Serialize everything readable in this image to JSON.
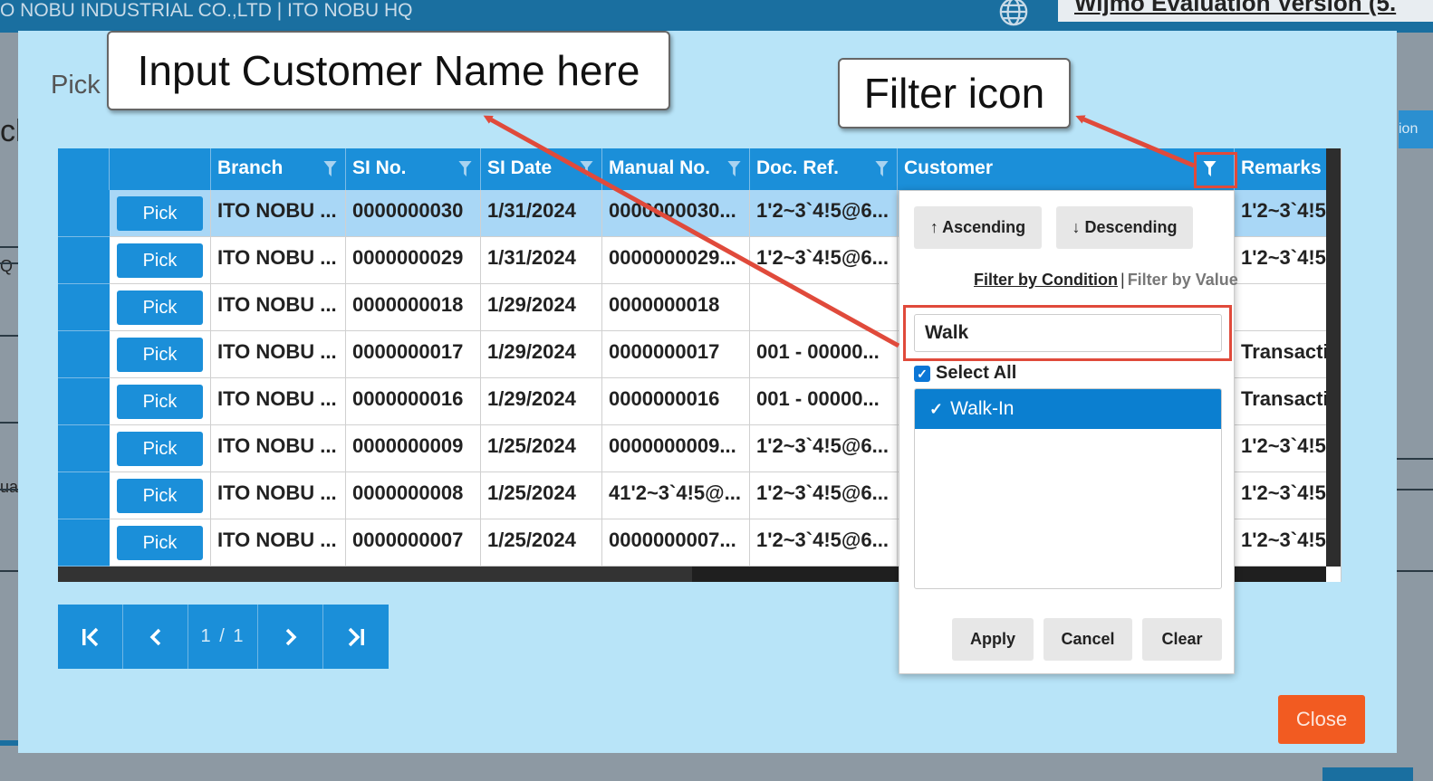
{
  "app": {
    "company": "O NOBU INDUSTRIAL CO.,LTD | ITO NOBU HQ",
    "evaluation_banner": "Wijmo Evaluation Version (5."
  },
  "background": {
    "pk": "ck",
    "q": "Q",
    "ual": "ual",
    "right_btn": "ion"
  },
  "modal": {
    "title": "Pick S",
    "close_label": "Close"
  },
  "grid": {
    "columns": [
      "Branch",
      "SI No.",
      "SI Date",
      "Manual No.",
      "Doc. Ref.",
      "Customer",
      "Remarks"
    ],
    "pick_label": "Pick",
    "rows": [
      {
        "branch": "ITO NOBU ...",
        "si_no": "0000000030",
        "si_date": "1/31/2024",
        "manual_no": "0000000030...",
        "doc_ref": "1'2~3`4!5@6...",
        "customer": "",
        "remarks": "1'2~3`4!5"
      },
      {
        "branch": "ITO NOBU ...",
        "si_no": "0000000029",
        "si_date": "1/31/2024",
        "manual_no": "0000000029...",
        "doc_ref": "1'2~3`4!5@6...",
        "customer": "",
        "remarks": "1'2~3`4!5"
      },
      {
        "branch": "ITO NOBU ...",
        "si_no": "0000000018",
        "si_date": "1/29/2024",
        "manual_no": "0000000018",
        "doc_ref": "",
        "customer": "",
        "remarks": ""
      },
      {
        "branch": "ITO NOBU ...",
        "si_no": "0000000017",
        "si_date": "1/29/2024",
        "manual_no": "0000000017",
        "doc_ref": "001 - 00000...",
        "customer": "",
        "remarks": "Transacti"
      },
      {
        "branch": "ITO NOBU ...",
        "si_no": "0000000016",
        "si_date": "1/29/2024",
        "manual_no": "0000000016",
        "doc_ref": "001 - 00000...",
        "customer": "",
        "remarks": "Transacti"
      },
      {
        "branch": "ITO NOBU ...",
        "si_no": "0000000009",
        "si_date": "1/25/2024",
        "manual_no": "0000000009...",
        "doc_ref": "1'2~3`4!5@6...",
        "customer": "",
        "remarks": "1'2~3`4!5"
      },
      {
        "branch": "ITO NOBU ...",
        "si_no": "0000000008",
        "si_date": "1/25/2024",
        "manual_no": "41'2~3`4!5@...",
        "doc_ref": "1'2~3`4!5@6...",
        "customer": "",
        "remarks": "1'2~3`4!5"
      },
      {
        "branch": "ITO NOBU ...",
        "si_no": "0000000007",
        "si_date": "1/25/2024",
        "manual_no": "0000000007...",
        "doc_ref": "1'2~3`4!5@6...",
        "customer": "",
        "remarks": "1'2~3`4!5"
      }
    ]
  },
  "pager": {
    "first": "|<",
    "prev": "<",
    "info": "1 / 1",
    "next": ">",
    "last": ">|"
  },
  "filter_popup": {
    "ascending": "↑ Ascending",
    "descending": "↓ Descending",
    "filter_by_condition": "Filter by Condition",
    "separator": "|",
    "filter_by_value": "Filter by Value",
    "search_value": "Walk",
    "select_all": "Select All",
    "items": [
      {
        "label": "Walk-In",
        "checked": true
      }
    ],
    "apply": "Apply",
    "cancel": "Cancel",
    "clear": "Clear"
  },
  "callouts": {
    "customer_name": "Input Customer Name here",
    "filter_icon": "Filter icon"
  },
  "colors": {
    "header_blue": "#1b8fd9",
    "modal_bg": "#b8e4f8",
    "close_orange": "#f25b21",
    "annotation_red": "#e04a3b"
  }
}
